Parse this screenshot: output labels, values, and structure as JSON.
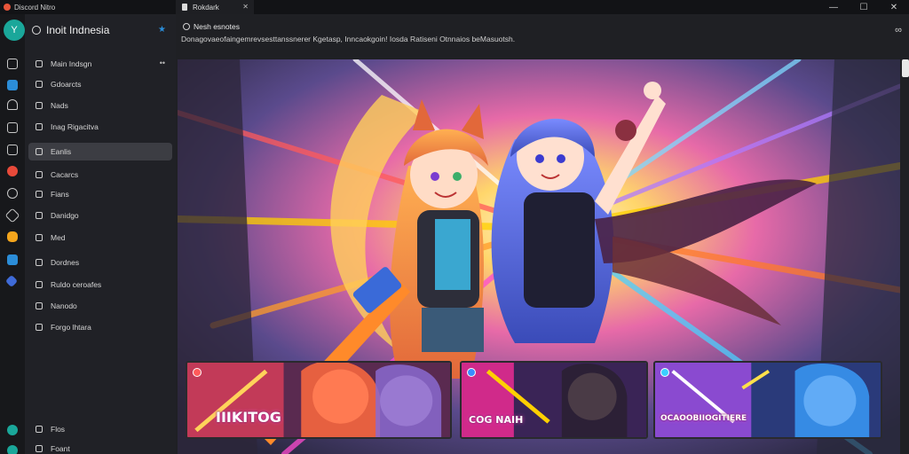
{
  "titlebar": {
    "app_title": "Discord Nitro",
    "tab_label": "Rokdark",
    "minimize": "—",
    "maximize": "☐",
    "close": "✕",
    "tab_close": "✕"
  },
  "server": {
    "name": "Inoit Indnesia",
    "star": "★",
    "avatar_glyph": "Y"
  },
  "sidebar": {
    "items": [
      {
        "label": "Main Indsgn"
      },
      {
        "label": "Gdoarcts"
      },
      {
        "label": "Nads"
      },
      {
        "label": "Inag Rigacitva"
      },
      {
        "label": "Eanlis"
      },
      {
        "label": "Cacarcs"
      },
      {
        "label": "Fians"
      },
      {
        "label": "Danidgo"
      },
      {
        "label": "Med"
      },
      {
        "label": "Dordnes"
      },
      {
        "label": "Ruldo ceroafes"
      },
      {
        "label": "Nanodo"
      },
      {
        "label": "Forgo lhtara"
      },
      {
        "label": "Flos"
      },
      {
        "label": "Foant"
      }
    ],
    "dots": "••",
    "active_index": 4
  },
  "channel": {
    "title": "Nesh esnotes",
    "description": "Donagovaeofaingemrevsesttanssnerer Kgetasp, Inncaokgoin! Iosda Ratiseni Otnnaios beMasuotsh.",
    "link_icon": "∞"
  },
  "cards": [
    {
      "label": "IIIKITOG",
      "accent": "#ff6a3d"
    },
    {
      "label": "COG NAIH",
      "accent": "#ffb400"
    },
    {
      "label": "OCAOOBIIOGITIERE",
      "accent": "#ff3cd8"
    }
  ],
  "colors": {
    "accent_teal": "#1aa79a",
    "link_blue": "#2b8dd8",
    "sidebar_bg": "#202126",
    "main_bg": "#1f2024"
  }
}
